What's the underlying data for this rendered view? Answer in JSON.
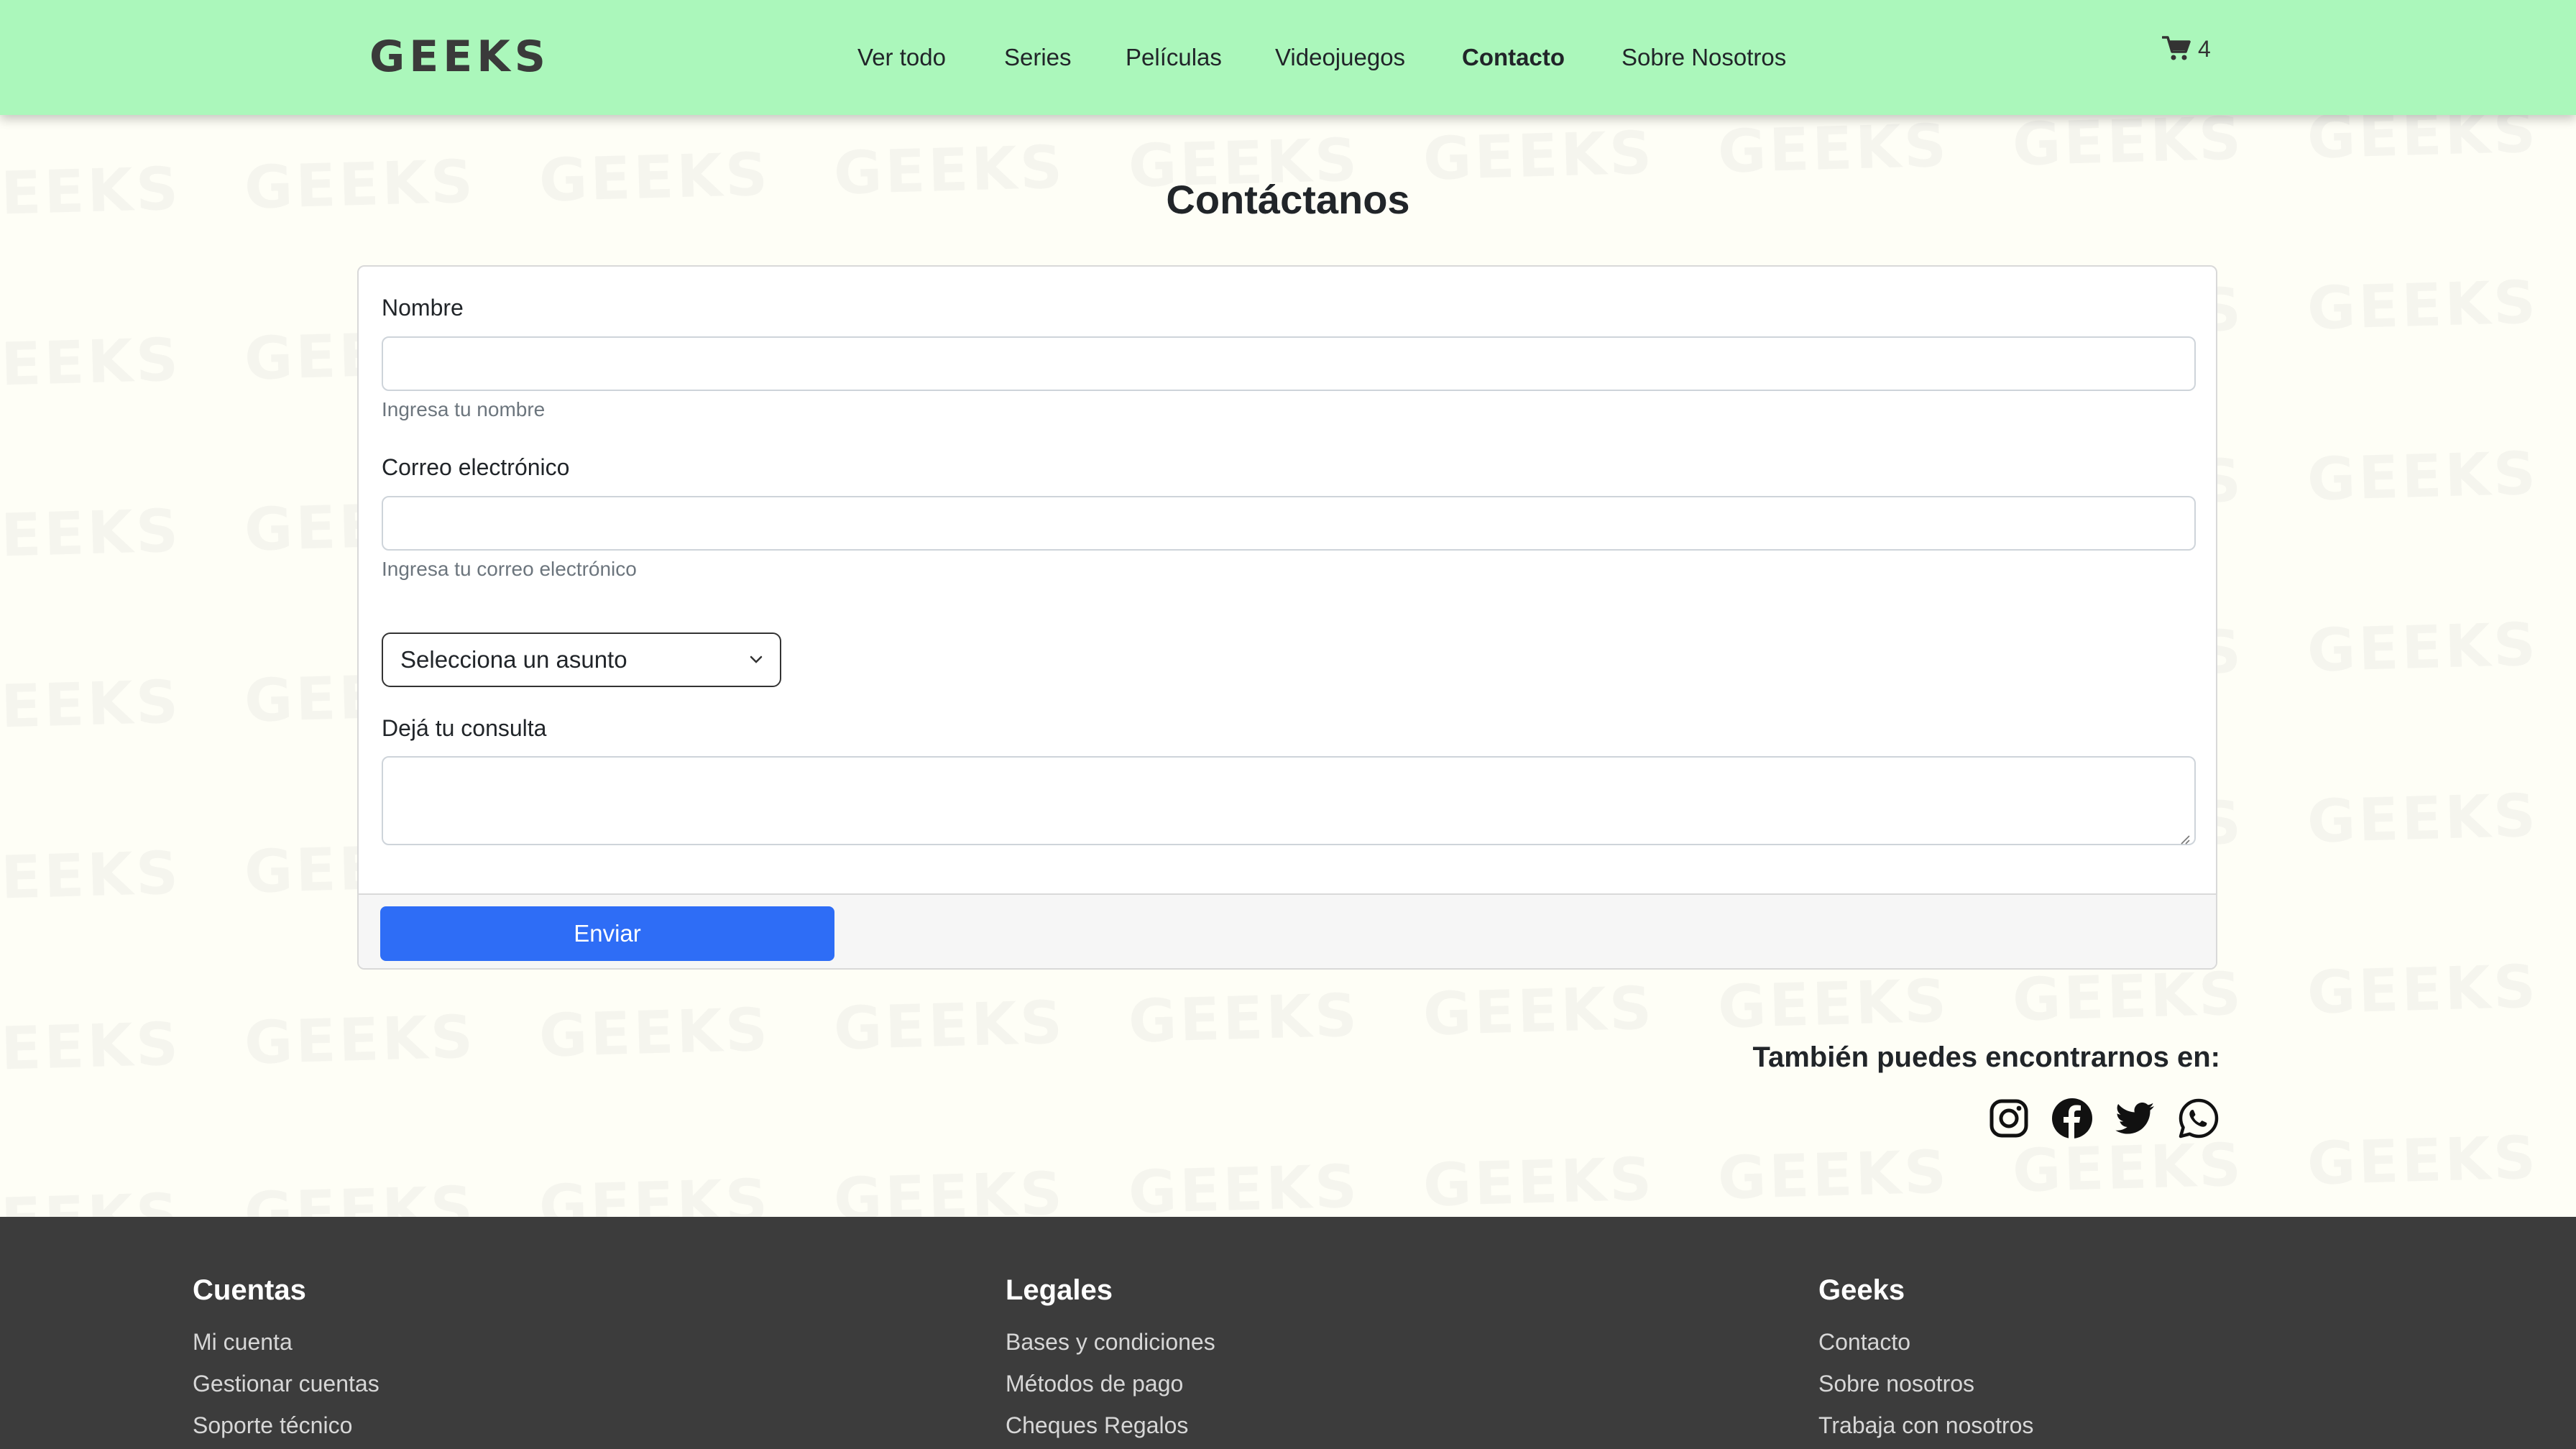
{
  "brand": {
    "logo_text": "GEEKS"
  },
  "nav": {
    "items": [
      {
        "label": "Ver todo",
        "active": false
      },
      {
        "label": "Series",
        "active": false
      },
      {
        "label": "Películas",
        "active": false
      },
      {
        "label": "Videojuegos",
        "active": false
      },
      {
        "label": "Contacto",
        "active": true
      },
      {
        "label": "Sobre Nosotros",
        "active": false
      }
    ],
    "cart_icon": "shopping-cart-icon",
    "cart_count": "4"
  },
  "watermark_text": "GEEKS",
  "contact": {
    "title": "Contáctanos",
    "name_label": "Nombre",
    "name_value": "",
    "name_help": "Ingresa tu nombre",
    "email_label": "Correo electrónico",
    "email_value": "",
    "email_help": "Ingresa tu correo electrónico",
    "subject_selected": "Selecciona un asunto",
    "query_label": "Dejá tu consulta",
    "query_value": "",
    "submit_label": "Enviar"
  },
  "social": {
    "heading": "También puedes encontrarnos en:",
    "icons": [
      "instagram-icon",
      "facebook-icon",
      "twitter-icon",
      "whatsapp-icon"
    ]
  },
  "footer": {
    "columns": [
      {
        "heading": "Cuentas",
        "links": [
          "Mi cuenta",
          "Gestionar cuentas",
          "Soporte técnico"
        ]
      },
      {
        "heading": "Legales",
        "links": [
          "Bases y condiciones",
          "Métodos de pago",
          "Cheques Regalos"
        ]
      },
      {
        "heading": "Geeks",
        "links": [
          "Contacto",
          "Sobre nosotros",
          "Trabaja con nosotros"
        ]
      }
    ]
  },
  "colors": {
    "header_bg": "#abf7bb",
    "page_bg": "#fefef6",
    "primary_button": "#2e6df6",
    "footer_bg": "#3c3c3c"
  }
}
